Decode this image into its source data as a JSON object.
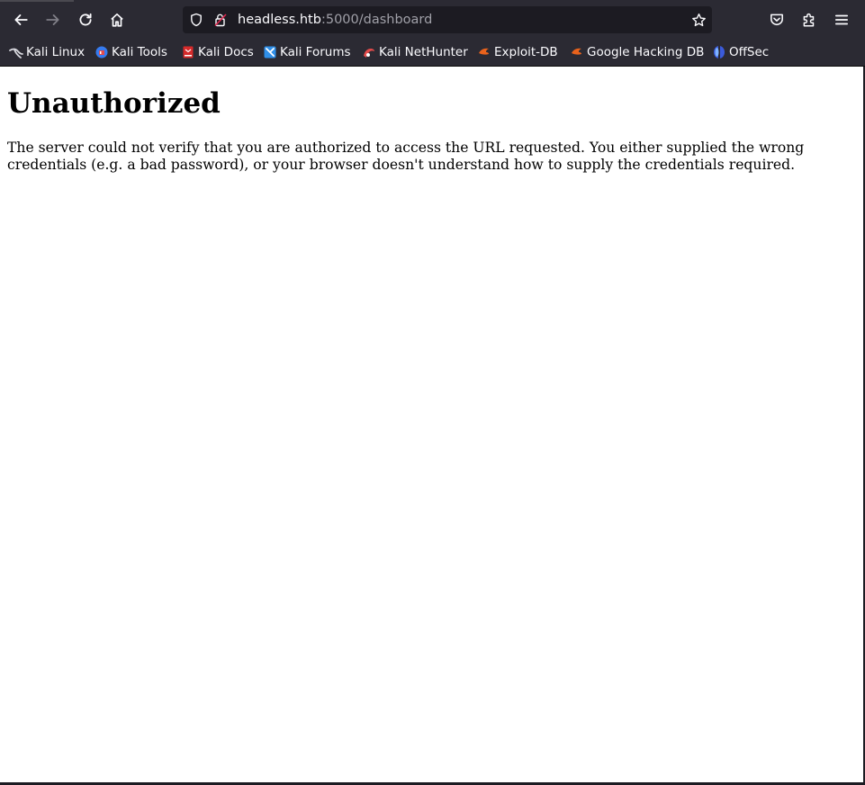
{
  "browser": {
    "url_host": "headless.htb",
    "url_path": ":5000/dashboard",
    "icons": {
      "back": "arrow-left-icon",
      "forward": "arrow-right-icon",
      "reload": "reload-icon",
      "home": "home-icon",
      "tracking": "shield-icon",
      "security": "lock-warning-icon",
      "bookmark": "star-icon",
      "pocket": "pocket-icon",
      "extensions": "puzzle-icon",
      "menu": "hamburger-menu-icon"
    },
    "colors": {
      "toolbar": "#2b2a33",
      "url_field": "#1c1b22",
      "text": "#fbfbfe",
      "muted_text": "#a0a0a8"
    }
  },
  "bookmarks": [
    {
      "label": "Kali Linux",
      "icon": "kali-dragon-icon"
    },
    {
      "label": "Kali Tools",
      "icon": "kali-tools-icon"
    },
    {
      "label": "Kali Docs",
      "icon": "kali-docs-icon"
    },
    {
      "label": "Kali Forums",
      "icon": "kali-forums-icon"
    },
    {
      "label": "Kali NetHunter",
      "icon": "nethunter-icon"
    },
    {
      "label": "Exploit-DB",
      "icon": "exploit-db-icon"
    },
    {
      "label": "Google Hacking DB",
      "icon": "ghdb-icon"
    },
    {
      "label": "OffSec",
      "icon": "offsec-icon"
    }
  ],
  "page": {
    "heading": "Unauthorized",
    "message": "The server could not verify that you are authorized to access the URL requested. You either supplied the wrong credentials (e.g. a bad password), or your browser doesn't understand how to supply the credentials required."
  }
}
